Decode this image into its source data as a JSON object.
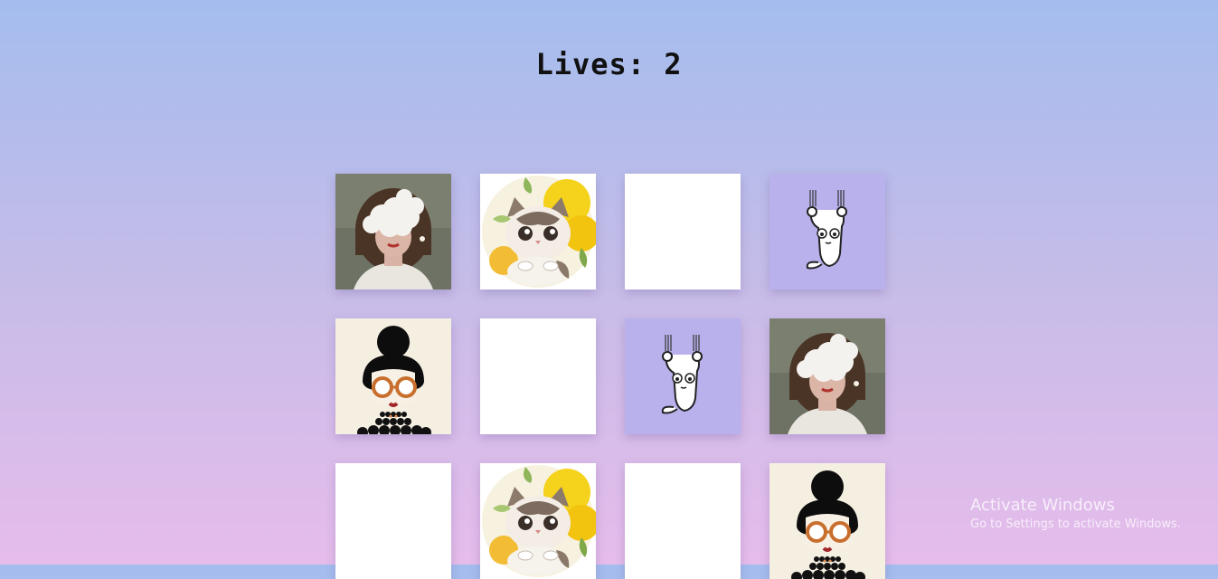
{
  "status": {
    "lives_text": "Lives: 2",
    "lives_value": 2
  },
  "board": {
    "rows": 3,
    "columns": 4,
    "cards": [
      {
        "state": "revealed",
        "image": "woman-cloud-face"
      },
      {
        "state": "revealed",
        "image": "cat-yellow-flowers"
      },
      {
        "state": "hidden",
        "image": ""
      },
      {
        "state": "revealed",
        "image": "cat-hanging-claws"
      },
      {
        "state": "revealed",
        "image": "woman-bun-sunglasses"
      },
      {
        "state": "hidden",
        "image": ""
      },
      {
        "state": "revealed",
        "image": "cat-hanging-claws"
      },
      {
        "state": "revealed",
        "image": "woman-cloud-face"
      },
      {
        "state": "hidden",
        "image": ""
      },
      {
        "state": "revealed",
        "image": "cat-yellow-flowers"
      },
      {
        "state": "hidden",
        "image": ""
      },
      {
        "state": "revealed",
        "image": "woman-bun-sunglasses"
      }
    ]
  },
  "watermark": {
    "title": "Activate Windows",
    "subtitle": "Go to Settings to activate Windows."
  },
  "colors": {
    "background_top": "#a4bdee",
    "background_bottom": "#e6bceb",
    "card_back": "#ffffff",
    "hanging_cat_bg": "#b8b1ec",
    "bun_woman_bg": "#f5efe2"
  }
}
